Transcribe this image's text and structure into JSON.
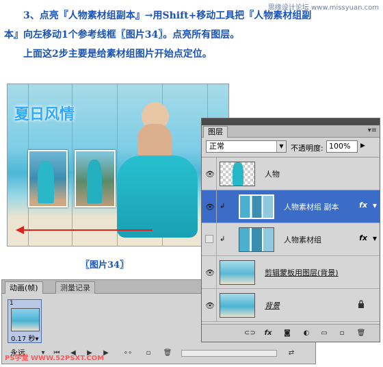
{
  "tutorial": {
    "watermark_top": "思缘设计论坛 www.missyuan.com",
    "line1": "3、点亮『人物素材组副本』→用Shift+移动工具把『人物素材组副",
    "line2": "本』向左移动1个参考线框〖图片34〗。点亮所有图层。",
    "line3": "上面这2步主要是给素材组图片开始点定位。"
  },
  "scene": {
    "title_art": "夏日风情",
    "caption": "〖图片34〗"
  },
  "animation_panel": {
    "tabs": [
      "动画(帧)",
      "测量记录"
    ],
    "frame_number": "1",
    "frame_delay": "0.17 秒▾",
    "loop": "永远",
    "watermark": "PS学堂 WWW.52PSXT.COM"
  },
  "layers_panel": {
    "tab": "图层",
    "blend_mode": "正常",
    "opacity_label": "不透明度:",
    "opacity_value": "100%",
    "layers": [
      {
        "name": "人物",
        "visible": true,
        "selected": false,
        "clipped": false,
        "fx": false,
        "locked": false
      },
      {
        "name": "人物素材组 副本",
        "visible": true,
        "selected": true,
        "clipped": true,
        "fx": true,
        "locked": false
      },
      {
        "name": "人物素材组",
        "visible": false,
        "selected": false,
        "clipped": true,
        "fx": true,
        "locked": false
      },
      {
        "name": "剪辑蒙板用图层(背景)",
        "visible": true,
        "selected": false,
        "clipped": false,
        "fx": false,
        "locked": false
      },
      {
        "name": "背景",
        "visible": true,
        "selected": false,
        "clipped": false,
        "fx": false,
        "locked": true
      }
    ],
    "fx_label": "fx",
    "footer_icons": [
      "link-icon",
      "fx-icon",
      "mask-icon",
      "adjustment-icon",
      "group-icon",
      "new-layer-icon",
      "trash-icon"
    ]
  },
  "colors": {
    "tutorial_text": "#1a53b5",
    "selected_layer": "#3a6cc8",
    "arrow": "#e0201a"
  }
}
